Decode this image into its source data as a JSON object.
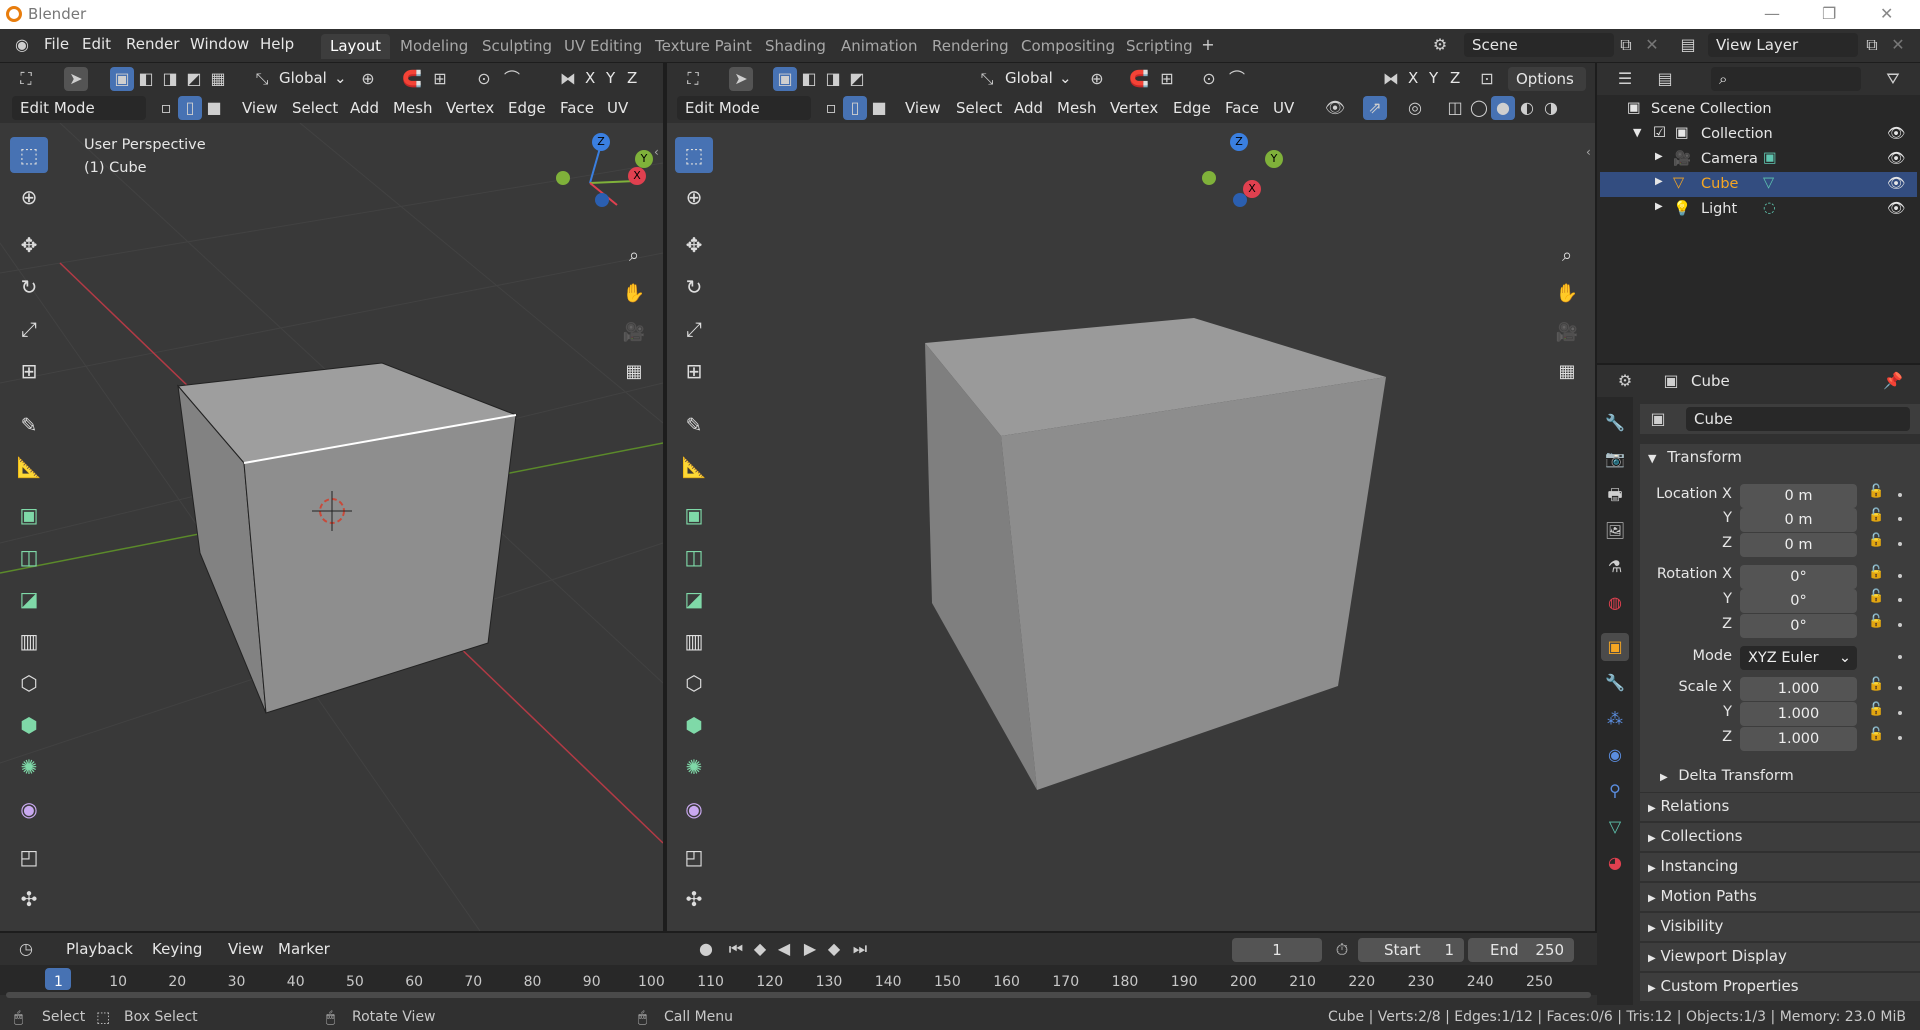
{
  "app": {
    "title": "Blender"
  },
  "menu": [
    "File",
    "Edit",
    "Render",
    "Window",
    "Help"
  ],
  "workspaces": [
    "Layout",
    "Modeling",
    "Sculpting",
    "UV Editing",
    "Texture Paint",
    "Shading",
    "Animation",
    "Rendering",
    "Compositing",
    "Scripting"
  ],
  "scene": {
    "name": "Scene",
    "view_layer": "View Layer"
  },
  "viewport_left": {
    "orientation": "Global",
    "mode": "Edit Mode",
    "menus": [
      "View",
      "Select",
      "Add",
      "Mesh",
      "Vertex",
      "Edge",
      "Face",
      "UV"
    ],
    "overlay_title": "User Perspective",
    "overlay_object": "(1) Cube",
    "axes": {
      "x": "X",
      "y": "Y",
      "z": "Z"
    }
  },
  "viewport_right": {
    "orientation": "Global",
    "mode": "Edit Mode",
    "menus": [
      "View",
      "Select",
      "Add",
      "Mesh",
      "Vertex",
      "Edge",
      "Face",
      "UV"
    ],
    "options_label": "Options",
    "axes": {
      "x": "X",
      "y": "Y",
      "z": "Z"
    }
  },
  "outliner": {
    "root": "Scene Collection",
    "collection": "Collection",
    "items": [
      "Camera",
      "Cube",
      "Light"
    ],
    "selected": "Cube"
  },
  "properties": {
    "object_name": "Cube",
    "datablock_name": "Cube",
    "transform_title": "Transform",
    "location_label": "Location X",
    "rotation_label": "Rotation X",
    "scale_label": "Scale X",
    "y_label": "Y",
    "z_label": "Z",
    "location": [
      "0 m",
      "0 m",
      "0 m"
    ],
    "rotation": [
      "0°",
      "0°",
      "0°"
    ],
    "mode_label": "Mode",
    "mode_value": "XYZ Euler",
    "scale": [
      "1.000",
      "1.000",
      "1.000"
    ],
    "delta": "Delta Transform",
    "panels": [
      "Relations",
      "Collections",
      "Instancing",
      "Motion Paths",
      "Visibility",
      "Viewport Display",
      "Custom Properties"
    ]
  },
  "timeline": {
    "menus": [
      "Playback",
      "Keying",
      "View",
      "Marker"
    ],
    "current_frame": "1",
    "start_label": "Start",
    "start": "1",
    "end_label": "End",
    "end": "250",
    "ticks": [
      "1",
      "10",
      "20",
      "30",
      "40",
      "50",
      "60",
      "70",
      "80",
      "90",
      "100",
      "110",
      "120",
      "130",
      "140",
      "150",
      "160",
      "170",
      "180",
      "190",
      "200",
      "210",
      "220",
      "230",
      "240",
      "250"
    ]
  },
  "status": {
    "select": "Select",
    "box_select": "Box Select",
    "rotate_view": "Rotate View",
    "call_menu": "Call Menu",
    "stats": "Cube | Verts:2/8 | Edges:1/12 | Faces:0/6 | Tris:12 | Objects:1/3 | Memory: 23.0 MiB"
  },
  "colors": {
    "accent": "#4772b3",
    "axis_x": "#e0404f",
    "axis_y": "#7fb13a",
    "axis_z": "#3a7fe0",
    "active_obj": "#f5a623"
  }
}
